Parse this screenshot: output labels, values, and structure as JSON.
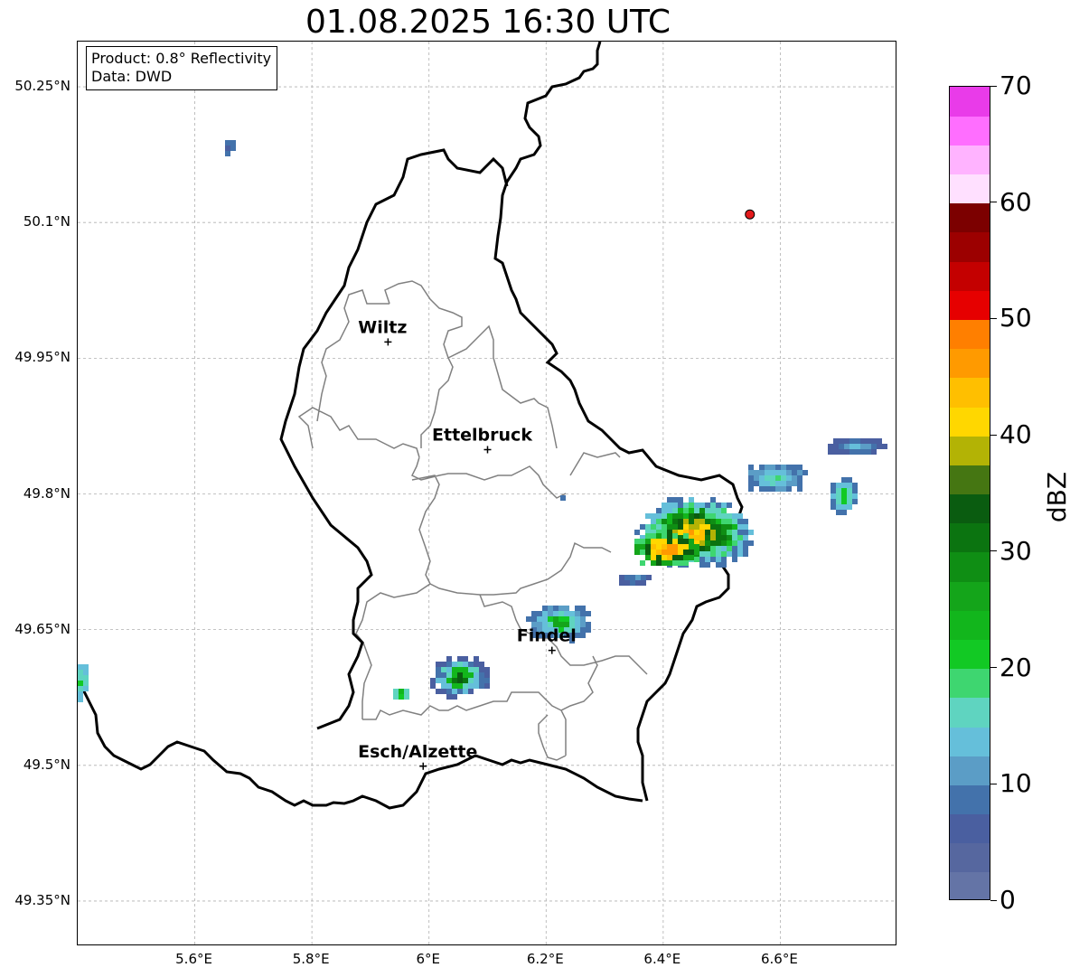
{
  "title": "01.08.2025 16:30 UTC",
  "info_box": {
    "product": "Product: 0.8° Reflectivity",
    "data": "Data: DWD"
  },
  "map": {
    "lon_range": [
      5.4,
      6.8
    ],
    "lat_range": [
      49.3,
      50.3
    ],
    "lat_ticks": [
      {
        "value": 50.25,
        "label": "50.25°N"
      },
      {
        "value": 50.1,
        "label": "50.1°N"
      },
      {
        "value": 49.95,
        "label": "49.95°N"
      },
      {
        "value": 49.8,
        "label": "49.8°N"
      },
      {
        "value": 49.65,
        "label": "49.65°N"
      },
      {
        "value": 49.5,
        "label": "49.5°N"
      },
      {
        "value": 49.35,
        "label": "49.35°N"
      }
    ],
    "lon_ticks": [
      {
        "value": 5.6,
        "label": "5.6°E"
      },
      {
        "value": 5.8,
        "label": "5.8°E"
      },
      {
        "value": 6.0,
        "label": "6°E"
      },
      {
        "value": 6.2,
        "label": "6.2°E"
      },
      {
        "value": 6.4,
        "label": "6.4°E"
      },
      {
        "value": 6.6,
        "label": "6.6°E"
      }
    ],
    "cities": [
      {
        "name": "Wiltz",
        "lon": 5.93,
        "lat": 49.968
      },
      {
        "name": "Ettelbruck",
        "lon": 6.1,
        "lat": 49.849
      },
      {
        "name": "Findel",
        "lon": 6.21,
        "lat": 49.627
      },
      {
        "name": "Esch/Alzette",
        "lon": 5.99,
        "lat": 49.499
      }
    ],
    "radar_marker": {
      "lon": 6.548,
      "lat": 50.109,
      "color": "#e31a1c"
    },
    "grid": true
  },
  "colorbar": {
    "label": "dBZ",
    "min": 0,
    "max": 70,
    "ticks": [
      0,
      10,
      20,
      30,
      40,
      50,
      60,
      70
    ],
    "tick_labels": [
      "0",
      "10",
      "20",
      "30",
      "40",
      "50",
      "60",
      "70"
    ],
    "colors": [
      "#6474a6",
      "#56679f",
      "#4a5fa0",
      "#4372ab",
      "#5b9dc6",
      "#65bfda",
      "#5fd4c0",
      "#3ed670",
      "#12c924",
      "#12b61c",
      "#14a51a",
      "#0f8e14",
      "#0b7410",
      "#0a5c10",
      "#457612",
      "#b3b305",
      "#ffd700",
      "#ffbf00",
      "#ff9a00",
      "#ff7f00",
      "#e60000",
      "#c40000",
      "#9c0000",
      "#7c0000",
      "#ffe0ff",
      "#ffb3ff",
      "#ff6eff",
      "#e93be9"
    ]
  }
}
